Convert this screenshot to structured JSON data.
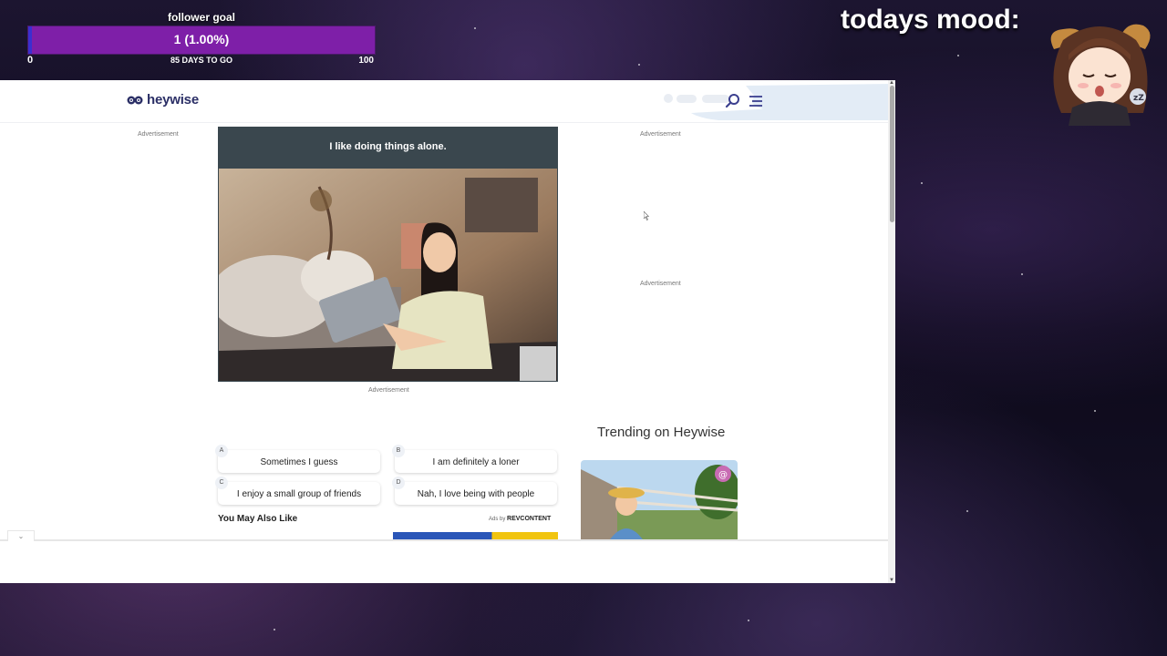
{
  "overlay": {
    "goal_title": "follower goal",
    "goal_value": "1 (1.00%)",
    "goal_min": "0",
    "goal_days": "85 DAYS TO GO",
    "goal_max": "100",
    "goal_progress_fraction": 0.01,
    "mood_title": "todays mood:"
  },
  "site": {
    "logo_text": "heywise",
    "brand_color": "#2b2f66"
  },
  "ads": {
    "label": "Advertisement"
  },
  "question": {
    "text": "I like doing things alone."
  },
  "answers": [
    {
      "letter": "A",
      "text": "Sometimes I guess"
    },
    {
      "letter": "B",
      "text": "I am definitely a loner"
    },
    {
      "letter": "C",
      "text": "I enjoy a small group of friends"
    },
    {
      "letter": "D",
      "text": "Nah, I love being with people"
    }
  ],
  "recommend": {
    "title": "You May Also Like",
    "ads_by": "Ads by",
    "provider": "REVCONTENT"
  },
  "trending": {
    "title": "Trending on Heywise"
  }
}
